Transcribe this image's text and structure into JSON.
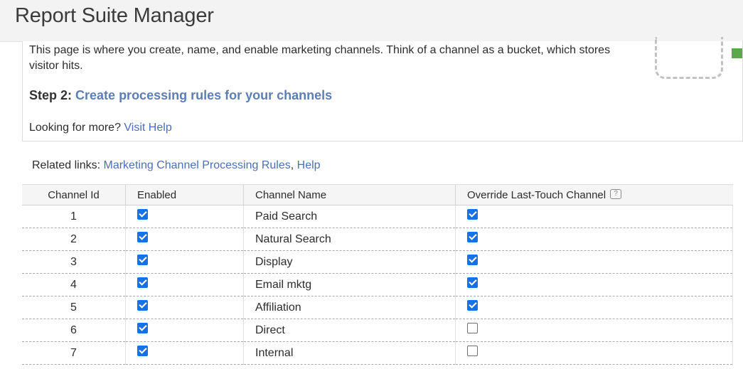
{
  "header": {
    "title": "Report Suite Manager"
  },
  "info": {
    "intro": "This page is where you create, name, and enable marketing channels. Think of a channel as a bucket, which stores visitor hits.",
    "step2_label": "Step 2:",
    "step2_link": "Create processing rules for your channels",
    "looking_text": "Looking for more?",
    "help_link": "Visit Help"
  },
  "related": {
    "label": "Related links:",
    "link1": "Marketing Channel Processing Rules",
    "separator": ",",
    "link2": "Help"
  },
  "table": {
    "headers": [
      "Channel Id",
      "Enabled",
      "Channel Name",
      "Override Last-Touch Channel"
    ],
    "help_icon": "?",
    "rows": [
      {
        "id": "1",
        "enabled": true,
        "name": "Paid Search",
        "override": true
      },
      {
        "id": "2",
        "enabled": true,
        "name": "Natural Search",
        "override": true
      },
      {
        "id": "3",
        "enabled": true,
        "name": "Display",
        "override": true
      },
      {
        "id": "4",
        "enabled": true,
        "name": "Email mktg",
        "override": true
      },
      {
        "id": "5",
        "enabled": true,
        "name": "Affiliation",
        "override": true
      },
      {
        "id": "6",
        "enabled": true,
        "name": "Direct",
        "override": false
      },
      {
        "id": "7",
        "enabled": true,
        "name": "Internal",
        "override": false
      }
    ]
  },
  "colors": {
    "accent": "#1473e6",
    "link": "#4b6fb3"
  }
}
